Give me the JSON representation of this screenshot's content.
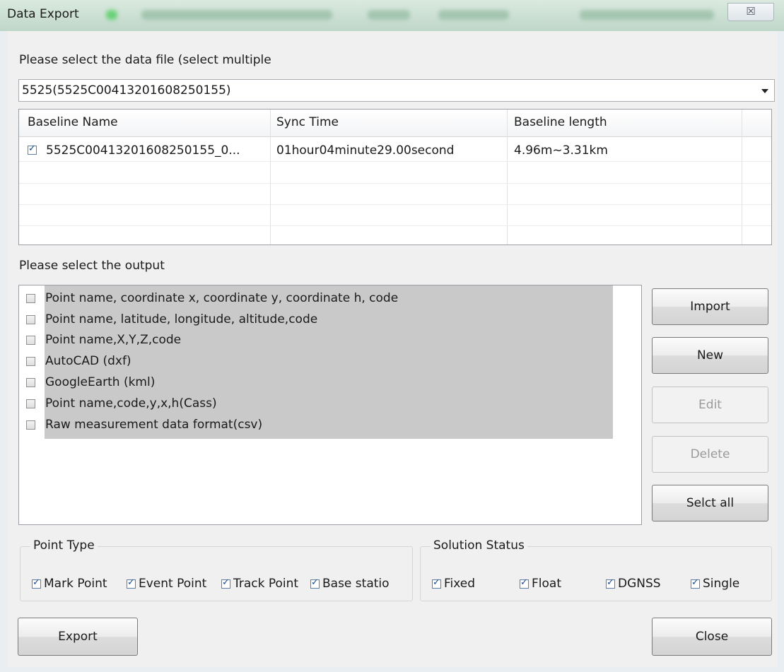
{
  "window": {
    "title": "Data Export",
    "close_glyph": "☒"
  },
  "file_select": {
    "label": "Please select the data file (select multiple",
    "selected": "5525(5525C00413201608250155)"
  },
  "baseline_table": {
    "columns": [
      "Baseline Name",
      "Sync Time",
      "Baseline length"
    ],
    "rows": [
      {
        "checked": true,
        "name": "5525C00413201608250155_0...",
        "sync_time": "01hour04minute29.00second",
        "length": "4.96m~3.31km"
      }
    ]
  },
  "output": {
    "label": "Please select the output",
    "items": [
      "Point name, coordinate x, coordinate y, coordinate h, code",
      "Point name, latitude, longitude, altitude,code",
      "Point name,X,Y,Z,code",
      "AutoCAD (dxf)",
      "GoogleEarth (kml)",
      "Point name,code,y,x,h(Cass)",
      "Raw measurement data format(csv)"
    ]
  },
  "side_buttons": {
    "import": "Import",
    "new": "New",
    "edit": "Edit",
    "delete": "Delete",
    "select_all": "Selct all"
  },
  "point_type": {
    "title": "Point Type",
    "items": [
      "Mark Point",
      "Event Point",
      "Track Point",
      "Base statio"
    ]
  },
  "solution_status": {
    "title": "Solution Status",
    "items": [
      "Fixed",
      "Float",
      "DGNSS",
      "Single"
    ]
  },
  "footer": {
    "export": "Export",
    "close": "Close"
  }
}
